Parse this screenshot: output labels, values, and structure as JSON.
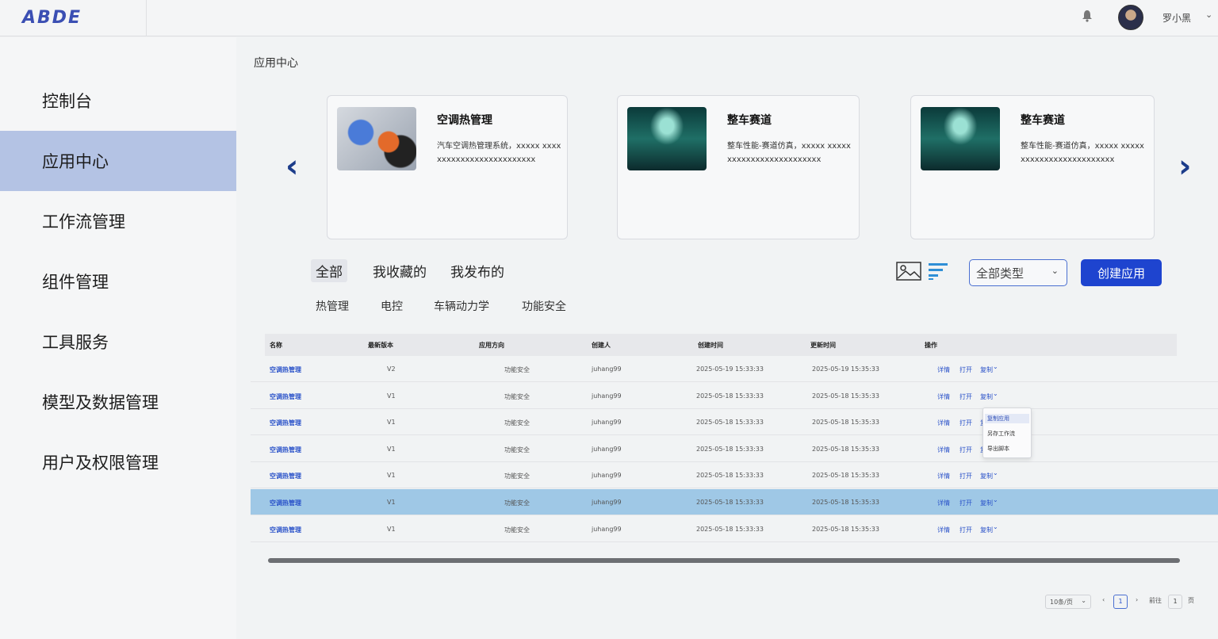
{
  "header": {
    "logo": "ABDE",
    "username": "罗小黑"
  },
  "sidebar": {
    "items": [
      {
        "label": "控制台",
        "active": false
      },
      {
        "label": "应用中心",
        "active": true
      },
      {
        "label": "工作流管理",
        "active": false
      },
      {
        "label": "组件管理",
        "active": false
      },
      {
        "label": "工具服务",
        "active": false
      },
      {
        "label": "模型及数据管理",
        "active": false
      },
      {
        "label": "用户及权限管理",
        "active": false
      }
    ]
  },
  "main": {
    "breadcrumb": "应用中心",
    "cards": [
      {
        "title": "空调热管理",
        "desc": "汽车空调热管理系统，xxxxx xxxxxxxxxxxxxxxxxxxxxxxxx",
        "image": "ac-thermal-image"
      },
      {
        "title": "整车赛道",
        "desc": "整车性能-赛道仿真，xxxxx xxxxxxxxxxxxxxxxxxxxxxxxx",
        "image": "race-track-image"
      },
      {
        "title": "整车赛道",
        "desc": "整车性能-赛道仿真，xxxxx xxxxxxxxxxxxxxxxxxxxxxxxx",
        "image": "race-track-image"
      }
    ],
    "tabs": [
      "全部",
      "我收藏的",
      "我发布的"
    ],
    "subtabs": [
      "热管理",
      "电控",
      "车辆动力学",
      "功能安全"
    ],
    "type_select": "全部类型",
    "create_button": "创建应用"
  },
  "table": {
    "columns": [
      "名称",
      "最新版本",
      "应用方向",
      "创建人",
      "创建时间",
      "更新时间",
      "操作"
    ],
    "rows": [
      {
        "name": "空调热管理",
        "version": "V2",
        "direction": "功能安全",
        "creator": "juhang99",
        "created": "2025-05-19 15:33:33",
        "updated": "2025-05-19 15:35:33"
      },
      {
        "name": "空调热管理",
        "version": "V1",
        "direction": "功能安全",
        "creator": "juhang99",
        "created": "2025-05-18 15:33:33",
        "updated": "2025-05-18 15:35:33"
      },
      {
        "name": "空调热管理",
        "version": "V1",
        "direction": "功能安全",
        "creator": "juhang99",
        "created": "2025-05-18 15:33:33",
        "updated": "2025-05-18 15:35:33"
      },
      {
        "name": "空调热管理",
        "version": "V1",
        "direction": "功能安全",
        "creator": "juhang99",
        "created": "2025-05-18 15:33:33",
        "updated": "2025-05-18 15:35:33"
      },
      {
        "name": "空调热管理",
        "version": "V1",
        "direction": "功能安全",
        "creator": "juhang99",
        "created": "2025-05-18 15:33:33",
        "updated": "2025-05-18 15:35:33"
      },
      {
        "name": "空调热管理",
        "version": "V1",
        "direction": "功能安全",
        "creator": "juhang99",
        "created": "2025-05-18 15:33:33",
        "updated": "2025-05-18 15:35:33"
      },
      {
        "name": "空调热管理",
        "version": "V1",
        "direction": "功能安全",
        "creator": "juhang99",
        "created": "2025-05-18 15:33:33",
        "updated": "2025-05-18 15:35:33"
      }
    ],
    "highlighted_row": 5,
    "actions": {
      "detail": "详情",
      "open": "打开",
      "copy": "复制"
    }
  },
  "dropdown": {
    "items": [
      "复制应用",
      "另存工作流",
      "导出脚本"
    ]
  },
  "pagination": {
    "page_size": "10条/页",
    "current_page": "1",
    "goto_label": "前往",
    "goto_value": "1",
    "page_suffix": "页"
  },
  "colors": {
    "primary": "#1e44cf",
    "sidebar_active": "#b4c3e4",
    "row_highlight": "#9fc8e6",
    "link": "#2a52c9"
  }
}
